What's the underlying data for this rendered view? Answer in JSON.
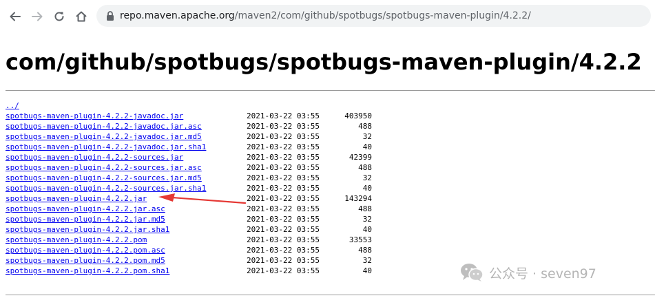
{
  "browser": {
    "url_host": "repo.maven.apache.org",
    "url_path": "/maven2/com/github/spotbugs/spotbugs-maven-plugin/4.2.2/"
  },
  "page": {
    "title": "com/github/spotbugs/spotbugs-maven-plugin/4.2.2"
  },
  "listing": {
    "parent_link": "../",
    "files": [
      {
        "name": "spotbugs-maven-plugin-4.2.2-javadoc.jar",
        "date": "2021-03-22 03:55",
        "size": "403950"
      },
      {
        "name": "spotbugs-maven-plugin-4.2.2-javadoc.jar.asc",
        "date": "2021-03-22 03:55",
        "size": "488"
      },
      {
        "name": "spotbugs-maven-plugin-4.2.2-javadoc.jar.md5",
        "date": "2021-03-22 03:55",
        "size": "32"
      },
      {
        "name": "spotbugs-maven-plugin-4.2.2-javadoc.jar.sha1",
        "date": "2021-03-22 03:55",
        "size": "40"
      },
      {
        "name": "spotbugs-maven-plugin-4.2.2-sources.jar",
        "date": "2021-03-22 03:55",
        "size": "42399"
      },
      {
        "name": "spotbugs-maven-plugin-4.2.2-sources.jar.asc",
        "date": "2021-03-22 03:55",
        "size": "488"
      },
      {
        "name": "spotbugs-maven-plugin-4.2.2-sources.jar.md5",
        "date": "2021-03-22 03:55",
        "size": "32"
      },
      {
        "name": "spotbugs-maven-plugin-4.2.2-sources.jar.sha1",
        "date": "2021-03-22 03:55",
        "size": "40"
      },
      {
        "name": "spotbugs-maven-plugin-4.2.2.jar",
        "date": "2021-03-22 03:55",
        "size": "143294"
      },
      {
        "name": "spotbugs-maven-plugin-4.2.2.jar.asc",
        "date": "2021-03-22 03:55",
        "size": "488"
      },
      {
        "name": "spotbugs-maven-plugin-4.2.2.jar.md5",
        "date": "2021-03-22 03:55",
        "size": "32"
      },
      {
        "name": "spotbugs-maven-plugin-4.2.2.jar.sha1",
        "date": "2021-03-22 03:55",
        "size": "40"
      },
      {
        "name": "spotbugs-maven-plugin-4.2.2.pom",
        "date": "2021-03-22 03:55",
        "size": "33553"
      },
      {
        "name": "spotbugs-maven-plugin-4.2.2.pom.asc",
        "date": "2021-03-22 03:55",
        "size": "488"
      },
      {
        "name": "spotbugs-maven-plugin-4.2.2.pom.md5",
        "date": "2021-03-22 03:55",
        "size": "32"
      },
      {
        "name": "spotbugs-maven-plugin-4.2.2.pom.sha1",
        "date": "2021-03-22 03:55",
        "size": "40"
      }
    ]
  },
  "watermark": {
    "text": "公众号 · seven97"
  },
  "colors": {
    "link": "#0000ee",
    "annotation": "#e53935",
    "address_bar": "#f1f3f4"
  },
  "icons": {
    "back": "arrow-left-icon",
    "forward": "arrow-right-icon",
    "reload": "reload-icon",
    "home": "home-icon",
    "lock": "lock-icon"
  }
}
